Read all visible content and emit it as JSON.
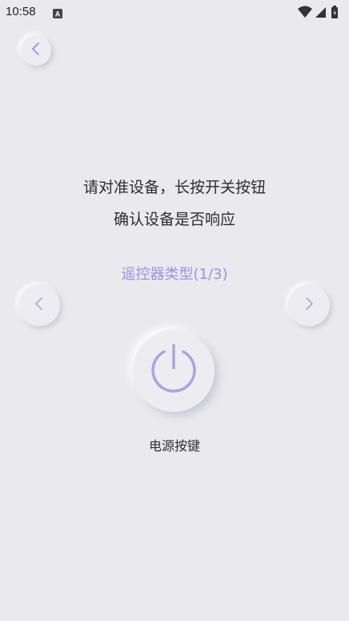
{
  "status_bar": {
    "time": "10:58",
    "notification_icon": "a-box-icon",
    "icons": [
      "wifi-icon",
      "signal-icon",
      "battery-icon"
    ]
  },
  "nav": {
    "back_icon": "chevron-left-icon"
  },
  "instructions": {
    "line1": "请对准设备，长按开关按钮",
    "line2": "确认设备是否响应"
  },
  "remote_type": {
    "label": "遥控器类型(1/3)"
  },
  "power_button": {
    "label": "电源按键",
    "icon": "power-icon"
  },
  "colors": {
    "accent": "#9b92dd",
    "background": "#e9e9ee",
    "icon_stroke": "#a9a4de"
  }
}
